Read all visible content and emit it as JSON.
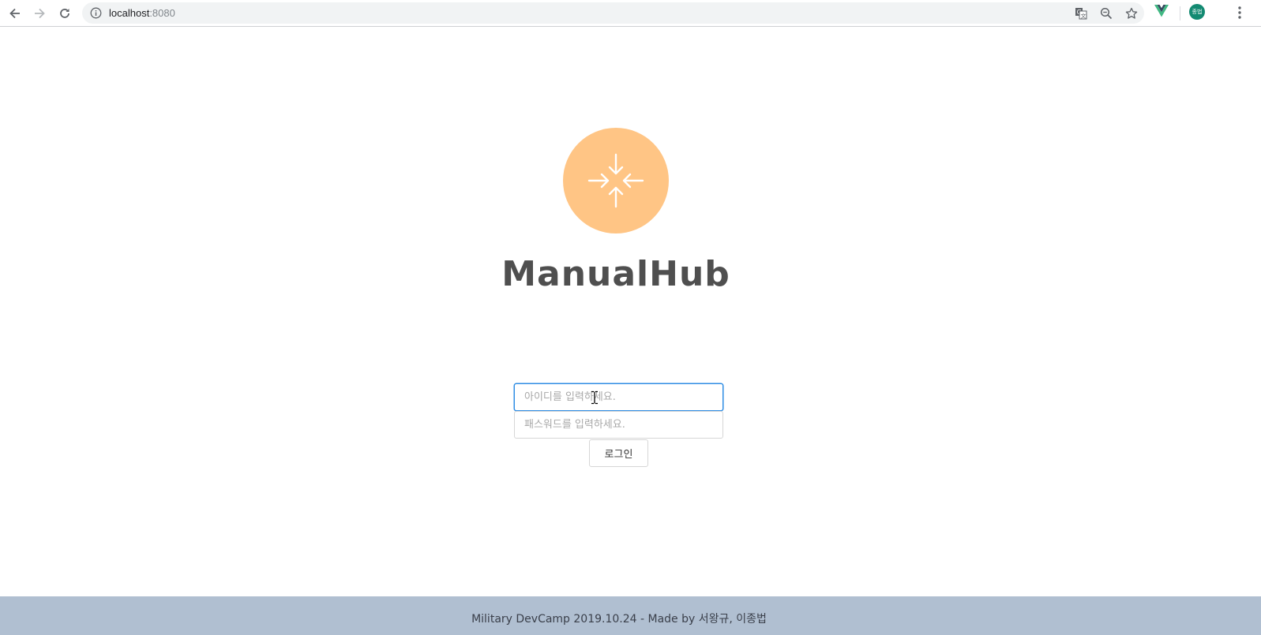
{
  "browser": {
    "url_host": "localhost",
    "url_port": ":8080",
    "profile_initials": "종법",
    "icons": [
      "back-icon",
      "forward-icon",
      "reload-icon",
      "info-icon",
      "translate-icon",
      "zoom-icon",
      "bookmark-star-icon",
      "vue-devtools-icon",
      "menu-dots-icon"
    ]
  },
  "app": {
    "brand_name": "ManualHub",
    "logo_icon": "arrows-inward-icon",
    "logo_color": "#ffc585"
  },
  "login": {
    "id_placeholder": "아이디를 입력하세요.",
    "password_placeholder": "패스워드를 입력하세요.",
    "login_label": "로그인",
    "focus_color": "#2f8de4"
  },
  "footer": {
    "text": "Military DevCamp 2019.10.24 - Made by 서왕규, 이종법",
    "background": "#b0bfd1"
  }
}
